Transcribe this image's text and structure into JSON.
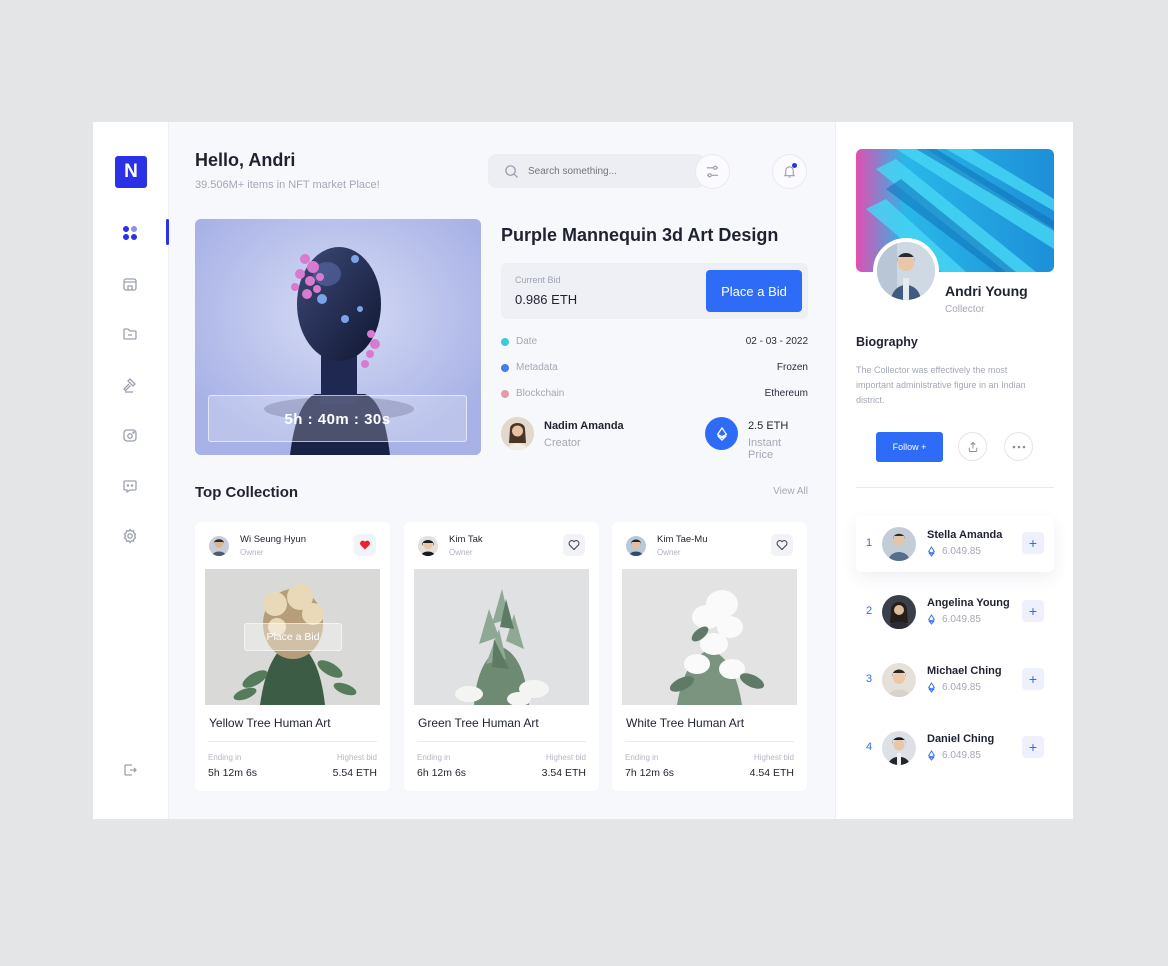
{
  "header": {
    "greeting": "Hello, Andri",
    "subtitle": "39.506M+ items in NFT market Place!",
    "search_placeholder": "Search something..."
  },
  "sidebar": {
    "logo_letter": "N",
    "items": [
      {
        "icon": "dashboard-icon"
      },
      {
        "icon": "store-icon"
      },
      {
        "icon": "folder-icon"
      },
      {
        "icon": "auction-hammer-icon"
      },
      {
        "icon": "wallet-icon"
      },
      {
        "icon": "chat-icon"
      },
      {
        "icon": "settings-icon"
      }
    ],
    "logout_icon": "logout-icon"
  },
  "featured": {
    "timer": "5h : 40m : 30s",
    "title": "Purple Mannequin 3d Art Design",
    "current_bid_label": "Current Bid",
    "current_bid": "0.986 ETH",
    "bid_button": "Place a Bid",
    "meta": [
      {
        "label": "Date",
        "value": "02 - 03 - 2022",
        "color": "#3fc8dc"
      },
      {
        "label": "Metadata",
        "value": "Frozen",
        "color": "#4a7cf0"
      },
      {
        "label": "Blockchain",
        "value": "Ethereum",
        "color": "#e79aa9"
      }
    ],
    "creator_name": "Nadim Amanda",
    "creator_role": "Creator",
    "price": "2.5 ETH",
    "price_label": "Instant Price"
  },
  "collection": {
    "title": "Top Collection",
    "view_all": "View All",
    "hover_button": "Place a Bid",
    "ending_label": "Ending in",
    "highest_label": "Highest bid",
    "cards": [
      {
        "owner": "Wi Seung Hyun",
        "role": "Owner",
        "name": "Yellow Tree Human Art",
        "ending": "5h 12m 6s",
        "bid": "5.54 ETH",
        "liked": true
      },
      {
        "owner": "Kim Tak",
        "role": "Owner",
        "name": "Green Tree Human Art",
        "ending": "6h 12m 6s",
        "bid": "3.54 ETH",
        "liked": false
      },
      {
        "owner": "Kim Tae-Mu",
        "role": "Owner",
        "name": "White Tree Human Art",
        "ending": "7h 12m 6s",
        "bid": "4.54 ETH",
        "liked": false
      }
    ]
  },
  "profile": {
    "name": "Andri Young",
    "role": "Collector",
    "bio_title": "Biography",
    "bio": "The Collector was effectively the most important administrative figure in an Indian district.",
    "follow_button": "Follow +"
  },
  "ranking": [
    {
      "rank": "1",
      "name": "Stella Amanda",
      "value": "6.049.85"
    },
    {
      "rank": "2",
      "name": "Angelina Young",
      "value": "6.049.85"
    },
    {
      "rank": "3",
      "name": "Michael Ching",
      "value": "6.049.85"
    },
    {
      "rank": "4",
      "name": "Daniel Ching",
      "value": "6.049.85"
    }
  ],
  "colors": {
    "brand": "#2b32e6",
    "accent": "#2e6bf6",
    "like": "#e5242f"
  }
}
